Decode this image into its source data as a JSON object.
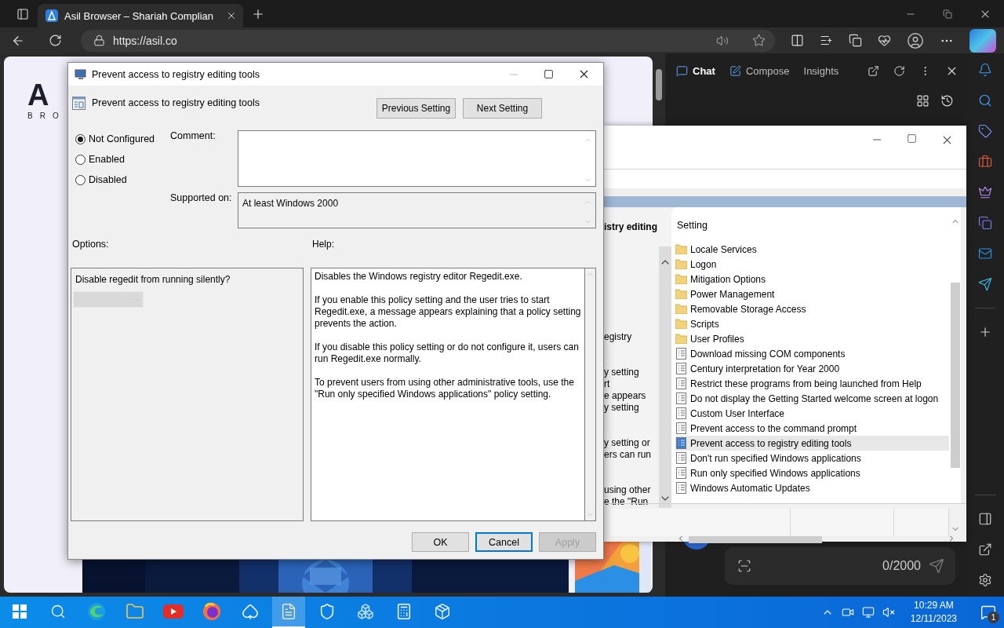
{
  "browser": {
    "tab_title": "Asil Browser – Shariah Complian",
    "url": "https://asil.co"
  },
  "page": {
    "logo": "A",
    "logo_subtitle": "BRO"
  },
  "copilot": {
    "tabs": [
      {
        "label": "Chat",
        "selected": true
      },
      {
        "label": "Compose",
        "selected": false
      },
      {
        "label": "Insights",
        "selected": false
      }
    ],
    "counter": "0/2000"
  },
  "policy_editor": {
    "details_heading": "istry editing",
    "details_paragraphs": [
      [
        "egistry"
      ],
      [
        "y setting",
        "rt",
        "e appears",
        "y setting"
      ],
      [
        "y setting or",
        "ers can run"
      ],
      [
        "using other",
        "e the \"Run"
      ]
    ],
    "column_header": "Setting",
    "items": [
      {
        "label": "Locale Services",
        "kind": "folder",
        "selected": false
      },
      {
        "label": "Logon",
        "kind": "folder",
        "selected": false
      },
      {
        "label": "Mitigation Options",
        "kind": "folder",
        "selected": false
      },
      {
        "label": "Power Management",
        "kind": "folder",
        "selected": false
      },
      {
        "label": "Removable Storage Access",
        "kind": "folder",
        "selected": false
      },
      {
        "label": "Scripts",
        "kind": "folder",
        "selected": false
      },
      {
        "label": "User Profiles",
        "kind": "folder",
        "selected": false
      },
      {
        "label": "Download missing COM components",
        "kind": "setting",
        "selected": false
      },
      {
        "label": "Century interpretation for Year 2000",
        "kind": "setting",
        "selected": false
      },
      {
        "label": "Restrict these programs from being launched from Help",
        "kind": "setting",
        "selected": false
      },
      {
        "label": "Do not display the Getting Started welcome screen at logon",
        "kind": "setting",
        "selected": false
      },
      {
        "label": "Custom User Interface",
        "kind": "setting",
        "selected": false
      },
      {
        "label": "Prevent access to the command prompt",
        "kind": "setting",
        "selected": false
      },
      {
        "label": "Prevent access to registry editing tools",
        "kind": "setting",
        "selected": true
      },
      {
        "label": "Don't run specified Windows applications",
        "kind": "setting",
        "selected": false
      },
      {
        "label": "Run only specified Windows applications",
        "kind": "setting",
        "selected": false
      },
      {
        "label": "Windows Automatic Updates",
        "kind": "setting",
        "selected": false
      }
    ]
  },
  "dialog": {
    "title": "Prevent access to registry editing tools",
    "heading": "Prevent access to registry editing tools",
    "nav_buttons": [
      "Previous Setting",
      "Next Setting"
    ],
    "states": [
      {
        "label": "Not Configured",
        "selected": true
      },
      {
        "label": "Enabled",
        "selected": false
      },
      {
        "label": "Disabled",
        "selected": false
      }
    ],
    "comment_label": "Comment:",
    "supported_label": "Supported on:",
    "supported_value": "At least Windows 2000",
    "options_label": "Options:",
    "help_label": "Help:",
    "option_prompt": "Disable regedit from running silently?",
    "help_paragraphs": [
      "Disables the Windows registry editor Regedit.exe.",
      "If you enable this policy setting and the user tries to start Regedit.exe, a message appears explaining that a policy setting prevents the action.",
      "If you disable this policy setting or do not configure it, users can run Regedit.exe normally.",
      "To prevent users from using other administrative tools, use the \"Run only specified Windows applications\" policy setting."
    ],
    "buttons": [
      {
        "label": "OK",
        "focused": false,
        "disabled": false
      },
      {
        "label": "Cancel",
        "focused": true,
        "disabled": false
      },
      {
        "label": "Apply",
        "focused": false,
        "disabled": true
      }
    ]
  },
  "taskbar": {
    "apps": [
      {
        "kind": "start",
        "active": false
      },
      {
        "kind": "search",
        "active": false
      },
      {
        "kind": "edge",
        "active": false
      },
      {
        "kind": "files",
        "active": false
      },
      {
        "kind": "video",
        "active": false
      },
      {
        "kind": "firefox",
        "active": false
      },
      {
        "kind": "cards",
        "active": false
      },
      {
        "kind": "notepad",
        "active": true
      },
      {
        "kind": "shield",
        "active": false
      },
      {
        "kind": "cubes",
        "active": false
      },
      {
        "kind": "calculator",
        "active": false
      },
      {
        "kind": "package",
        "active": false
      }
    ],
    "time": "10:29 AM",
    "date": "12/11/2023",
    "notification_count": "1"
  }
}
